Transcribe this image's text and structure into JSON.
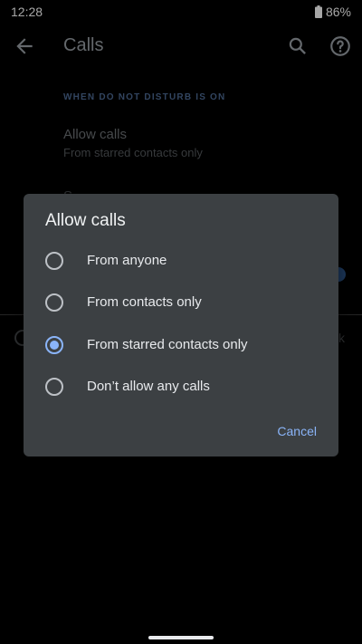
{
  "status_bar": {
    "time": "12:28",
    "battery": "86%",
    "battery_icon": "battery-icon"
  },
  "app_bar": {
    "title": "Calls",
    "back_icon": "arrow-back-icon",
    "search_icon": "search-icon",
    "help_icon": "help-icon"
  },
  "background": {
    "section_header": "WHEN DO NOT DISTURB IS ON",
    "allow_calls_title": "Allow calls",
    "allow_calls_summary": "From starred contacts only",
    "peek_text_1": "S",
    "peek_text_2": "k"
  },
  "dialog": {
    "title": "Allow calls",
    "options": [
      {
        "label": "From anyone",
        "selected": false
      },
      {
        "label": "From contacts only",
        "selected": false
      },
      {
        "label": "From starred contacts only",
        "selected": true
      },
      {
        "label": "Don’t allow any calls",
        "selected": false
      }
    ],
    "cancel_label": "Cancel"
  },
  "colors": {
    "accent": "#8ab4f8",
    "dialog_bg": "#3c4043",
    "background": "#000000"
  }
}
